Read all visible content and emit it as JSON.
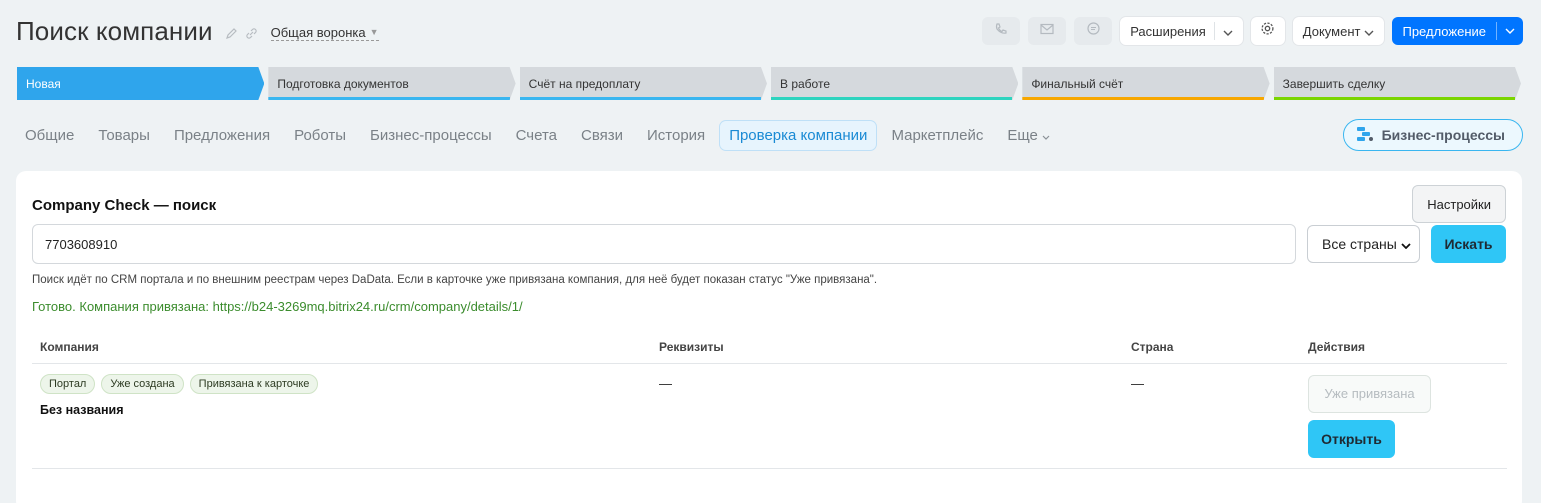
{
  "header": {
    "title": "Поиск компании",
    "funnel": "Общая воронка",
    "extensions_label": "Расширения",
    "document_label": "Документ",
    "offer_label": "Предложение"
  },
  "stages": [
    {
      "label": "Новая",
      "color": "#2fa5ec",
      "active": true
    },
    {
      "label": "Подготовка документов",
      "color": "#39b6f0"
    },
    {
      "label": "Счёт на предоплату",
      "color": "#39b6f0"
    },
    {
      "label": "В работе",
      "color": "#2dd4bf"
    },
    {
      "label": "Финальный счёт",
      "color": "#f7a700"
    },
    {
      "label": "Завершить сделку",
      "color": "#7bd500"
    }
  ],
  "tabs": [
    {
      "label": "Общие"
    },
    {
      "label": "Товары"
    },
    {
      "label": "Предложения"
    },
    {
      "label": "Роботы"
    },
    {
      "label": "Бизнес-процессы"
    },
    {
      "label": "Счета"
    },
    {
      "label": "Связи"
    },
    {
      "label": "История"
    },
    {
      "label": "Проверка компании",
      "active": true
    },
    {
      "label": "Маркетплейс"
    }
  ],
  "tab_more_label": "Еще",
  "bp_button_label": "Бизнес-процессы",
  "card": {
    "title": "Company Check — поиск",
    "settings_label": "Настройки",
    "search_value": "7703608910",
    "country_selected": "Все страны",
    "search_label": "Искать",
    "hint": "Поиск идёт по CRM портала и по внешним реестрам через DaData. Если в карточке уже привязана компания, для неё будет показан статус \"Уже привязана\".",
    "success": "Готово. Компания привязана: https://b24-3269mq.bitrix24.ru/crm/company/details/1/"
  },
  "table": {
    "headers": [
      "Компания",
      "Реквизиты",
      "Страна",
      "Действия"
    ],
    "rows": [
      {
        "badges": [
          "Портал",
          "Уже создана",
          "Привязана к карточке"
        ],
        "name": "Без названия",
        "requisites": "—",
        "country": "—",
        "linked_label": "Уже привязана",
        "open_label": "Открыть"
      }
    ]
  }
}
